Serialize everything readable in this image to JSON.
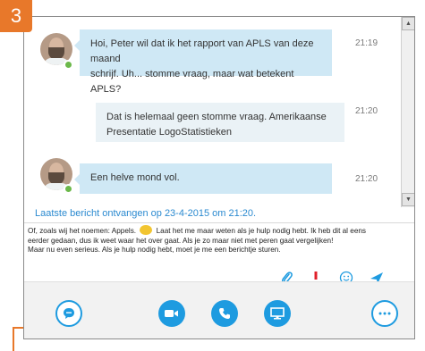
{
  "step_number": "3",
  "messages": [
    {
      "text_line1": "Hoi, Peter wil dat ik het rapport van APLS van deze maand",
      "text_line2": "schrijf. Uh... stomme vraag, maar wat betekent APLS?",
      "time": "21:19",
      "sender": "contact"
    },
    {
      "text_line1": "Dat is helemaal geen stomme vraag. Amerikaanse",
      "text_line2": "Presentatie LogoStatistieken",
      "time": "21:20",
      "sender": "self"
    },
    {
      "text_line1": "Een helve mond vol.",
      "time": "21:20",
      "sender": "contact"
    }
  ],
  "status": {
    "last_message": "Laatste bericht ontvangen op 23-4-2015 om 21:20."
  },
  "compose": {
    "line1_before": "Of, zoals wij het noemen: Appels.",
    "line1_after": "Laat het me maar weten als je hulp nodig hebt. Ik heb dit al eens",
    "line2": "eerder gedaan, dus ik weet waar het over gaat. Als je zo maar niet met peren gaat vergelijken!",
    "line3": "Maar nu even serieus. Als je hulp nodig hebt, moet je me een berichtje sturen."
  },
  "compose_icons": [
    "attachment-icon",
    "important-icon",
    "emoticon-icon",
    "send-icon"
  ],
  "toolbar_buttons": [
    "chat-button",
    "video-call-button",
    "audio-call-button",
    "share-screen-button",
    "more-options-button"
  ],
  "colors": {
    "accent": "#1e9be0",
    "badge": "#e8782a",
    "bubble": "#cfe8f5",
    "presence": "#6bb84a",
    "important": "#e0202a"
  }
}
